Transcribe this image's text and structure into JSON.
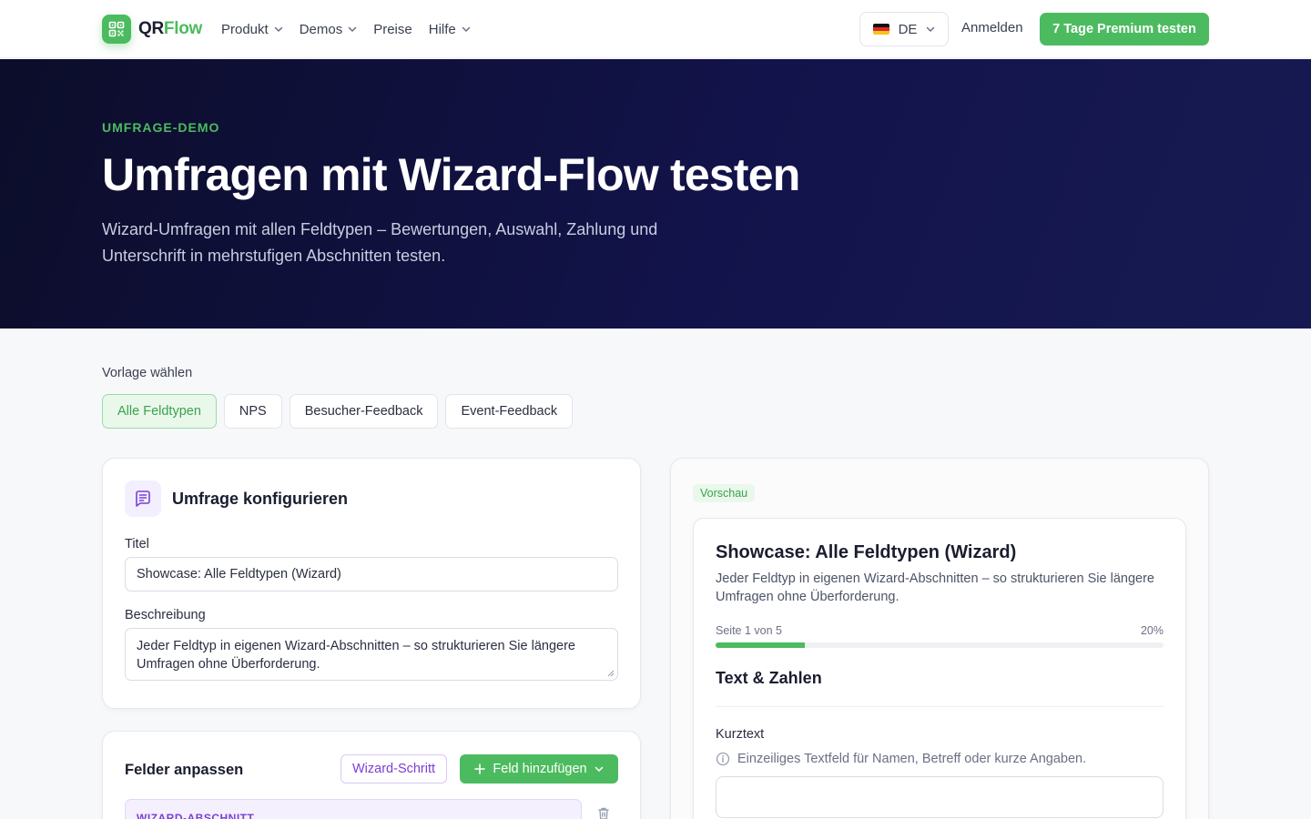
{
  "nav": {
    "logo_primary": "QR",
    "logo_accent": "Flow",
    "links": [
      {
        "label": "Produkt",
        "dropdown": true
      },
      {
        "label": "Demos",
        "dropdown": true
      },
      {
        "label": "Preise",
        "dropdown": false
      },
      {
        "label": "Hilfe",
        "dropdown": true
      }
    ],
    "language": "DE",
    "login_label": "Anmelden",
    "cta_label": "7 Tage Premium testen"
  },
  "hero": {
    "kicker": "UMFRAGE-DEMO",
    "title": "Umfragen mit Wizard-Flow testen",
    "subtitle": "Wizard-Umfragen mit allen Feldtypen – Bewertungen, Auswahl, Zahlung und Unterschrift in mehrstufigen Abschnitten testen."
  },
  "templates": {
    "label": "Vorlage wählen",
    "options": [
      "Alle Feldtypen",
      "NPS",
      "Besucher-Feedback",
      "Event-Feedback"
    ],
    "selected": "Alle Feldtypen"
  },
  "config": {
    "title": "Umfrage konfigurieren",
    "title_label": "Titel",
    "title_value": "Showcase: Alle Feldtypen (Wizard)",
    "description_label": "Beschreibung",
    "description_value": "Jeder Feldtyp in eigenen Wizard-Abschnitten – so strukturieren Sie längere Umfragen ohne Überforderung."
  },
  "fields": {
    "title": "Felder anpassen",
    "wizard_step_label": "Wizard-Schritt",
    "add_field_label": "Feld hinzufügen",
    "first_row_label": "WIZARD-ABSCHNITT"
  },
  "preview": {
    "badge": "Vorschau",
    "title": "Showcase: Alle Feldtypen (Wizard)",
    "description": "Jeder Feldtyp in eigenen Wizard-Abschnitten – so strukturieren Sie längere Umfragen ohne Überforderung.",
    "page_label": "Seite 1 von 5",
    "progress_label": "20%",
    "progress": 0.2,
    "section_title": "Text & Zahlen",
    "field_label": "Kurztext",
    "field_help": "Einzeiliges Textfeld für Namen, Betreff oder kurze Angaben.",
    "field_value": ""
  },
  "colors": {
    "brand": "#4cbb5f",
    "hero_bg": "#0c0d2a",
    "wizard_accent": "#7b3fd6"
  },
  "icons": {
    "logo": "qr-code-icon",
    "config": "form-icon",
    "help": "info-icon",
    "delete": "trash-icon"
  }
}
